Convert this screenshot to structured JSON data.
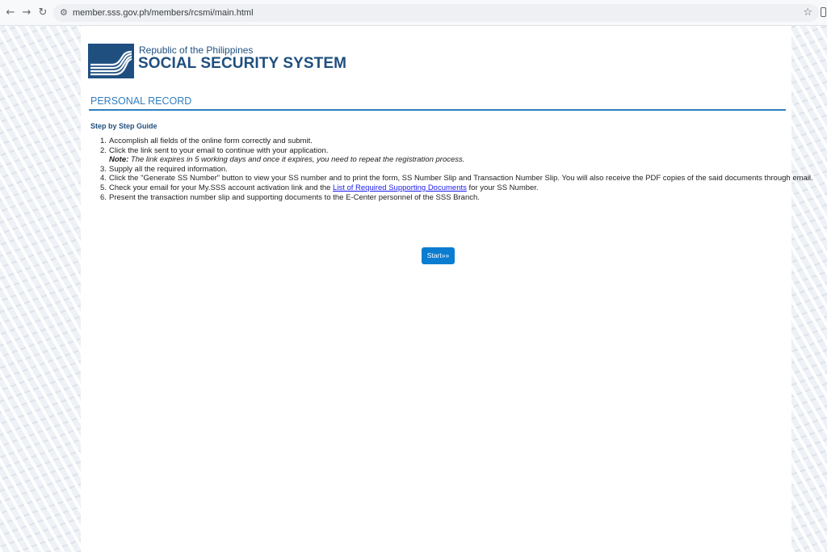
{
  "browser": {
    "url": "member.sss.gov.ph/members/rcsmi/main.html",
    "back_icon": "←",
    "forward_icon": "→",
    "reload_icon": "↻",
    "star_icon": "☆"
  },
  "header": {
    "republic": "Republic of the Philippines",
    "agency": "SOCIAL SECURITY SYSTEM"
  },
  "section": {
    "title": "PERSONAL RECORD"
  },
  "guide": {
    "title": "Step by Step Guide",
    "steps": [
      {
        "num": "1.",
        "text": "Accomplish all fields of the online form correctly and submit."
      },
      {
        "num": "2.",
        "text": "Click the link sent to your email to continue with your application.",
        "note_label": "Note:",
        "note_text": " The link expires in 5 working days and once it expires, you need to repeat the registration process."
      },
      {
        "num": "3.",
        "text": "Supply all the required information."
      },
      {
        "num": "4.",
        "text": "Click the \"Generate SS Number\" button to view your SS number and to print the form, SS Number Slip and Transaction Number Slip. You will also receive the PDF copies of the said documents through email."
      },
      {
        "num": "5.",
        "text_before": "Check your email for your My.SSS account activation link and the ",
        "link": "List of Required Supporting Documents",
        "text_after": " for your SS Number."
      },
      {
        "num": "6.",
        "text": "Present the transaction number slip and supporting documents to the E-Center personnel of the SSS Branch."
      }
    ]
  },
  "start_button": {
    "label": "Start»»"
  },
  "colors": {
    "brand": "#1f4f7f",
    "accent": "#2f7fc1",
    "button": "#0b7dd1",
    "link": "#1a1aee"
  }
}
